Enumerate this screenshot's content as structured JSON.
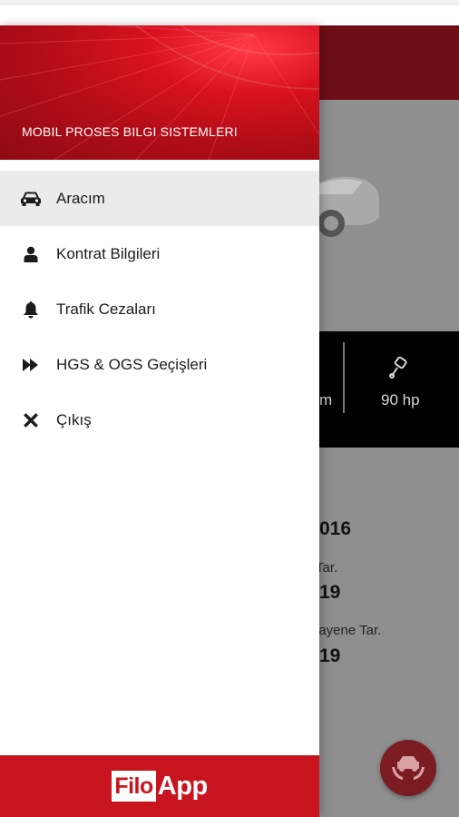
{
  "background_screen": {
    "spec_engine_partial": "m",
    "spec_power": "90 hp",
    "year_1_partial": "016",
    "label_1_partial": "Tar.",
    "year_2_partial": "19",
    "label_2_partial": "uayene Tar.",
    "year_3_partial": "19"
  },
  "drawer": {
    "subtitle": "MOBIL PROSES BILGI SISTEMLERI",
    "menu": [
      {
        "label": "Aracım",
        "icon": "car-icon",
        "active": true
      },
      {
        "label": "Kontrat Bilgileri",
        "icon": "user-icon",
        "active": false
      },
      {
        "label": "Trafik Cezaları",
        "icon": "bell-icon",
        "active": false
      },
      {
        "label": "HGS & OGS Geçişleri",
        "icon": "fast-forward-icon",
        "active": false
      },
      {
        "label": "Çıkış",
        "icon": "close-icon",
        "active": false
      }
    ],
    "logo_part1": "Filo",
    "logo_part2": "App"
  },
  "colors": {
    "brand_red": "#c8141f",
    "toolbar_dark_red": "#6e0f17",
    "active_row": "#ebebeb"
  }
}
